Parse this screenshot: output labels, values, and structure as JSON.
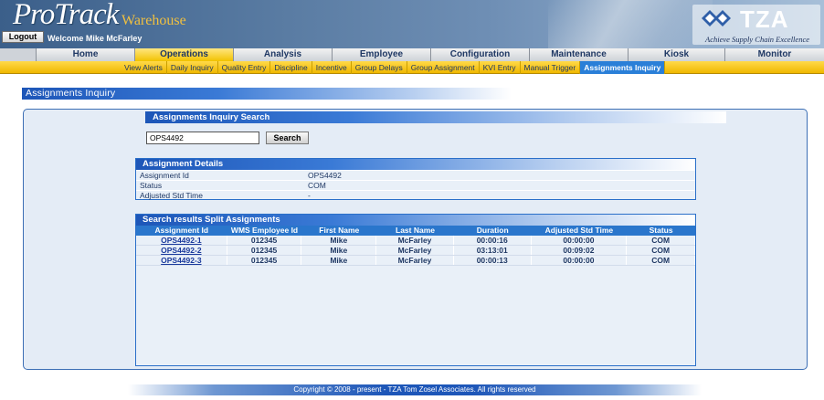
{
  "header": {
    "logo": "ProTrack",
    "logo_sub": "Warehouse",
    "logout_label": "Logout",
    "welcome": "Welcome Mike McFarley",
    "brand": "TZA",
    "tagline": "Achieve Supply Chain Excellence"
  },
  "main_nav": [
    {
      "label": "Home"
    },
    {
      "label": "Operations"
    },
    {
      "label": "Analysis"
    },
    {
      "label": "Employee"
    },
    {
      "label": "Configuration"
    },
    {
      "label": "Maintenance"
    },
    {
      "label": "Kiosk"
    },
    {
      "label": "Monitor"
    }
  ],
  "sub_nav": [
    {
      "label": "View Alerts"
    },
    {
      "label": "Daily Inquiry"
    },
    {
      "label": "Quality Entry"
    },
    {
      "label": "Discipline"
    },
    {
      "label": "Incentive"
    },
    {
      "label": "Group Delays"
    },
    {
      "label": "Group Assignment"
    },
    {
      "label": "KVI Entry"
    },
    {
      "label": "Manual Trigger"
    },
    {
      "label": "Assignments Inquiry"
    }
  ],
  "page": {
    "title": "Assignments Inquiry"
  },
  "search": {
    "title": "Assignments Inquiry Search",
    "value": "OPS4492",
    "button": "Search"
  },
  "details": {
    "title": "Assignment Details",
    "rows": [
      {
        "label": "Assignment Id",
        "value": "OPS4492"
      },
      {
        "label": "Status",
        "value": "COM"
      },
      {
        "label": "Adjusted Std Time",
        "value": "-"
      }
    ]
  },
  "results": {
    "title": "Search results Split Assignments",
    "columns": [
      "Assignment Id",
      "WMS Employee Id",
      "First Name",
      "Last Name",
      "Duration",
      "Adjusted Std Time",
      "Status"
    ],
    "rows": [
      [
        "OPS4492-1",
        "012345",
        "Mike",
        "McFarley",
        "00:00:16",
        "00:00:00",
        "COM"
      ],
      [
        "OPS4492-2",
        "012345",
        "Mike",
        "McFarley",
        "03:13:01",
        "00:09:02",
        "COM"
      ],
      [
        "OPS4492-3",
        "012345",
        "Mike",
        "McFarley",
        "00:00:13",
        "00:00:00",
        "COM"
      ]
    ]
  },
  "footer": {
    "text": "Copyright © 2008 - present - TZA Tom Zosel Associates. All rights reserved"
  },
  "colors": {
    "accent_blue": "#1d56b8",
    "nav_yellow": "#f2c200",
    "active_subtab": "#2a7fd8"
  }
}
